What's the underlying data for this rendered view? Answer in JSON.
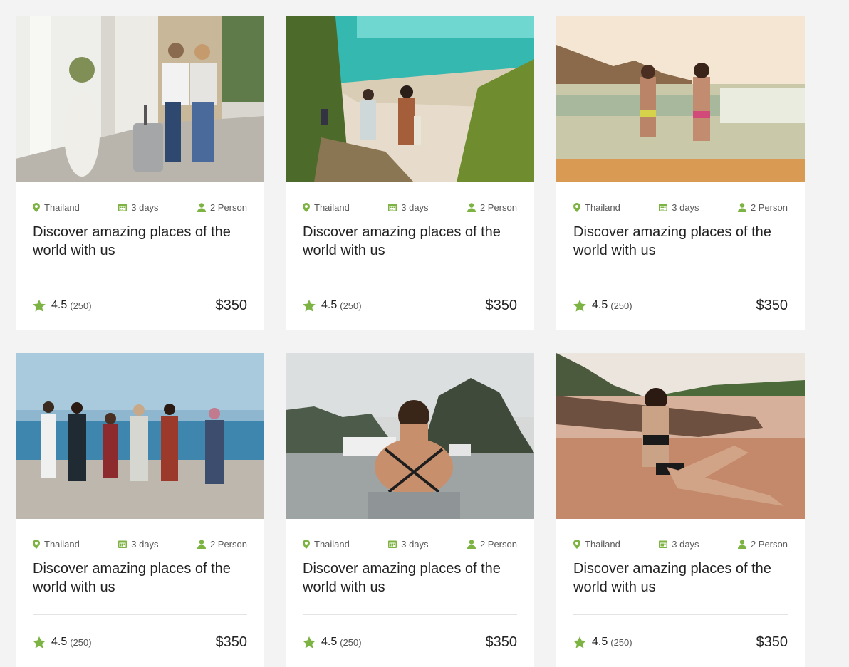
{
  "accent_color": "#7cb342",
  "cards": [
    {
      "location": "Thailand",
      "duration": "3 days",
      "people": "2 Person",
      "title": "Discover amazing places of the world with us",
      "rating": "4.5",
      "reviews": "(250)",
      "price": "$350",
      "photo": "couple-with-suitcase-street"
    },
    {
      "location": "Thailand",
      "duration": "3 days",
      "people": "2 Person",
      "title": "Discover amazing places of the world with us",
      "rating": "4.5",
      "reviews": "(250)",
      "price": "$350",
      "photo": "surfers-on-beach-path"
    },
    {
      "location": "Thailand",
      "duration": "3 days",
      "people": "2 Person",
      "title": "Discover amazing places of the world with us",
      "rating": "4.5",
      "reviews": "(250)",
      "price": "$350",
      "photo": "women-walking-into-sea"
    },
    {
      "location": "Thailand",
      "duration": "3 days",
      "people": "2 Person",
      "title": "Discover amazing places of the world with us",
      "rating": "4.5",
      "reviews": "(250)",
      "price": "$350",
      "photo": "friends-on-beach"
    },
    {
      "location": "Thailand",
      "duration": "3 days",
      "people": "2 Person",
      "title": "Discover amazing places of the world with us",
      "rating": "4.5",
      "reviews": "(250)",
      "price": "$350",
      "photo": "woman-in-bay-with-boat"
    },
    {
      "location": "Thailand",
      "duration": "3 days",
      "people": "2 Person",
      "title": "Discover amazing places of the world with us",
      "rating": "4.5",
      "reviews": "(250)",
      "price": "$350",
      "photo": "woman-sitting-on-shore"
    }
  ]
}
